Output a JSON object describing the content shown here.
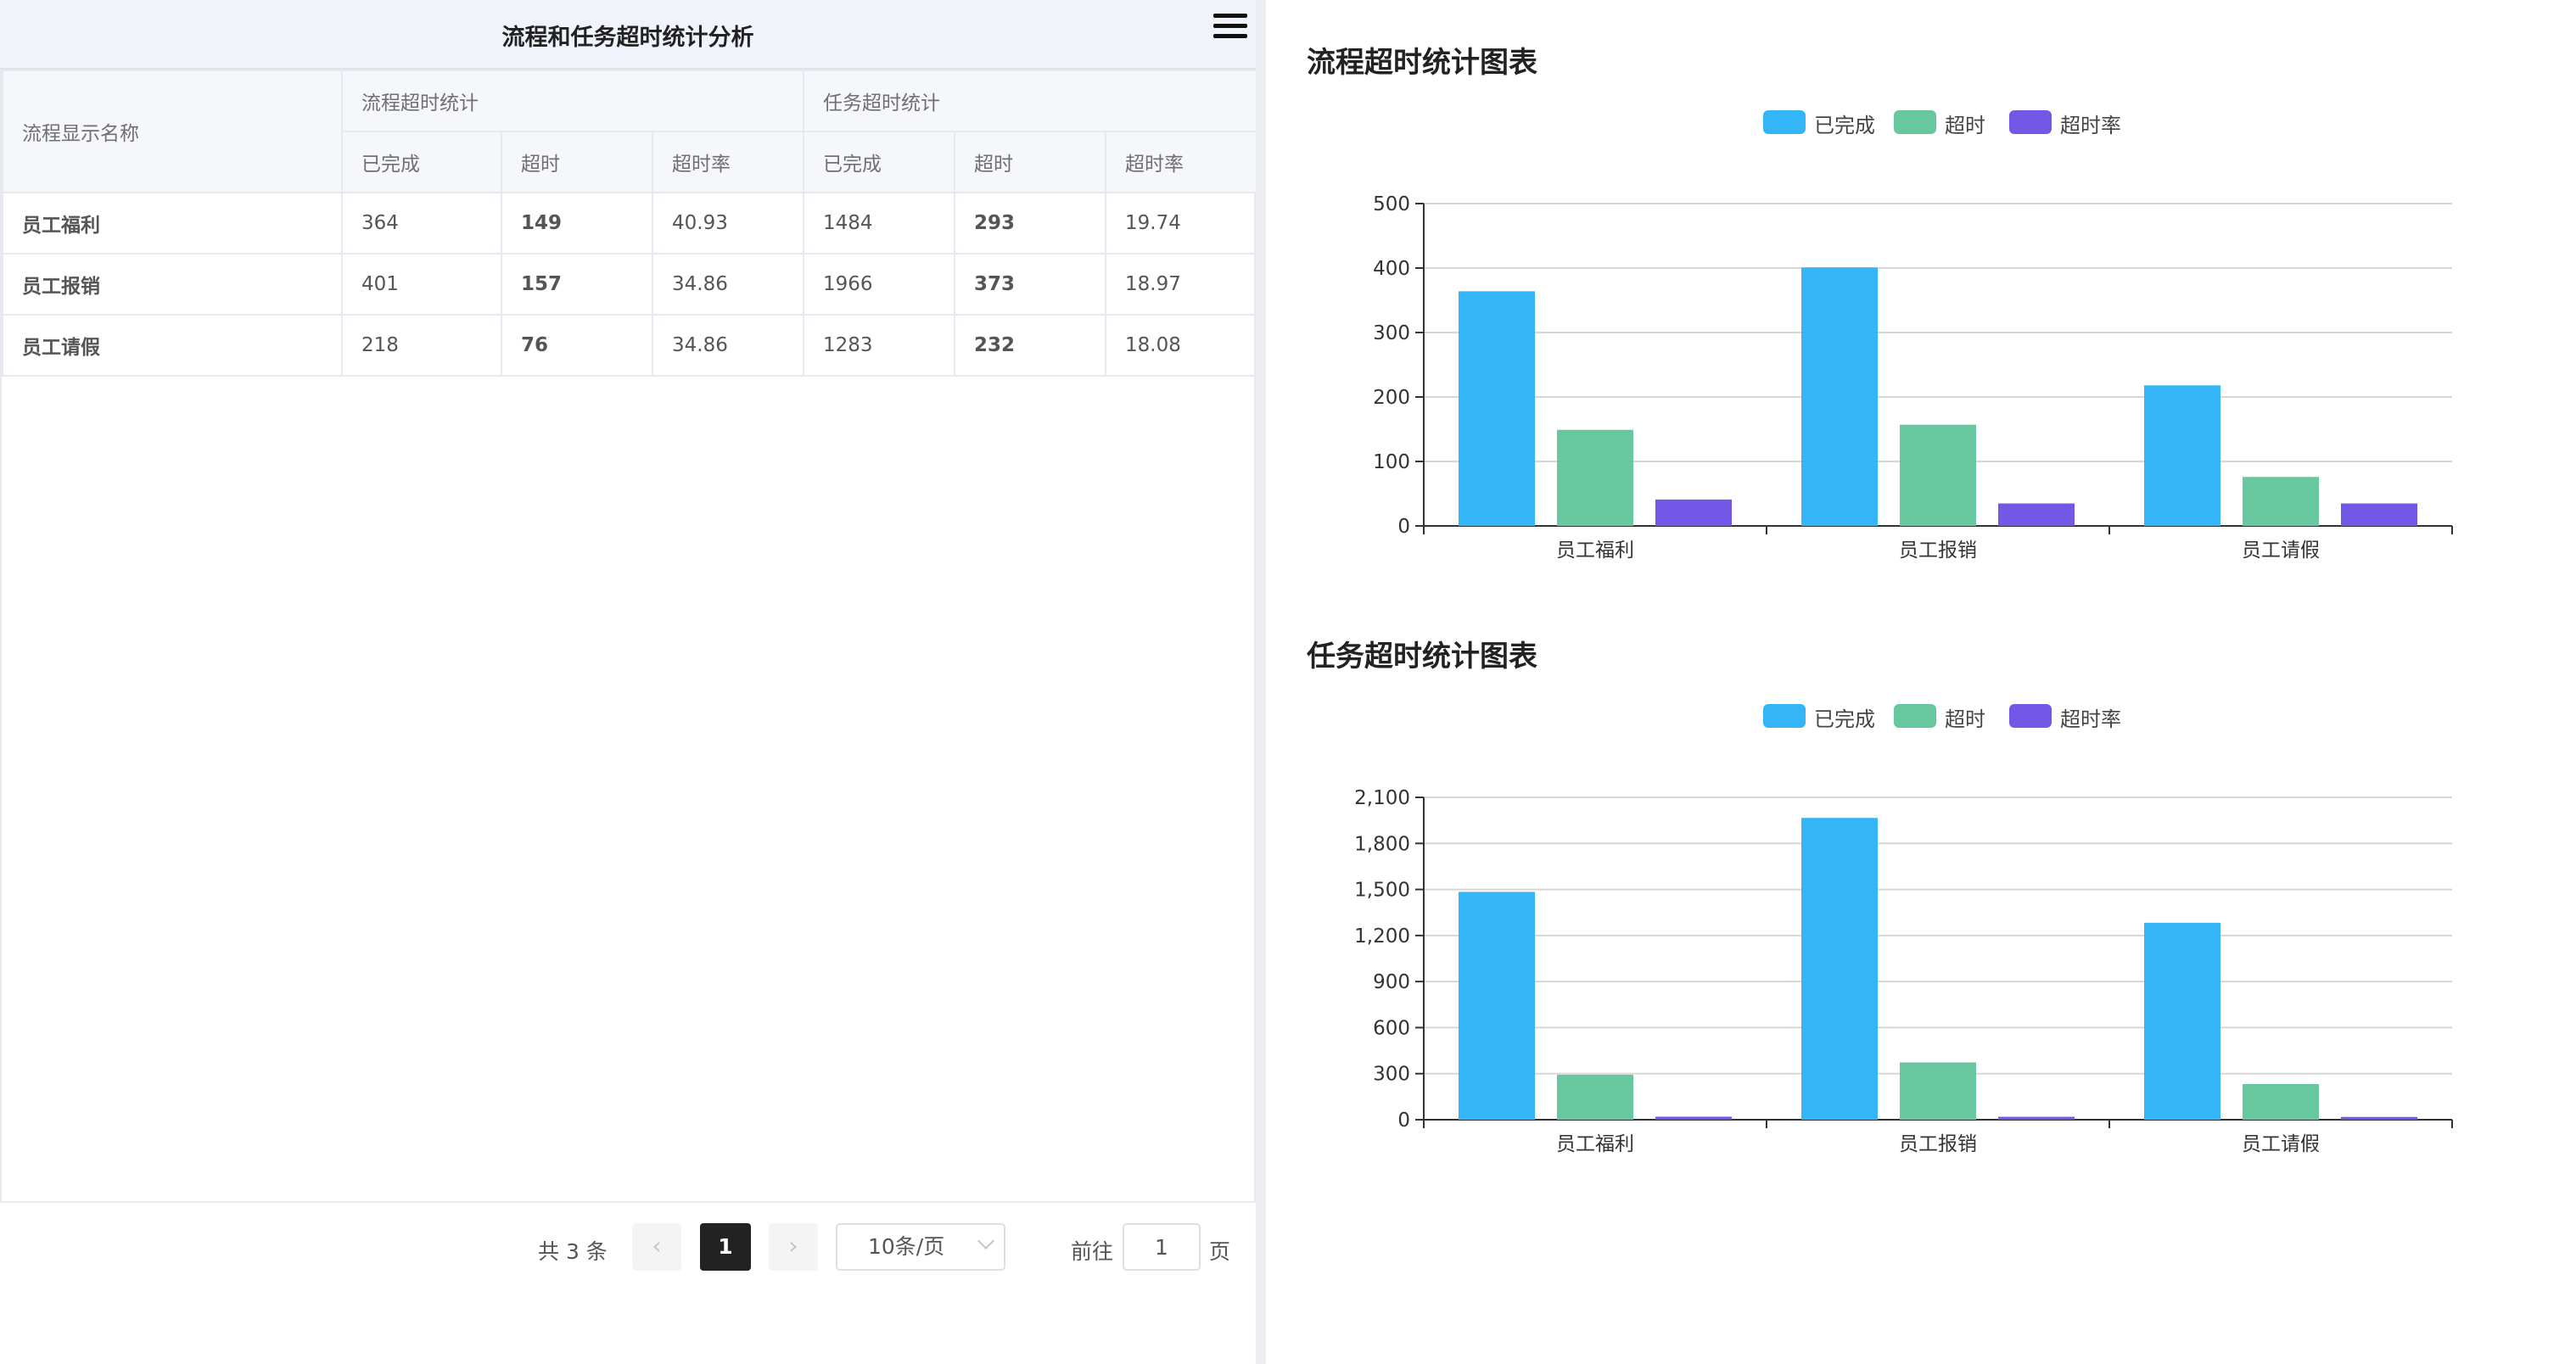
{
  "header": {
    "title": "流程和任务超时统计分析"
  },
  "table": {
    "name_header": "流程显示名称",
    "group_headers": [
      "流程超时统计",
      "任务超时统计"
    ],
    "sub_headers": [
      "已完成",
      "超时",
      "超时率",
      "已完成",
      "超时",
      "超时率"
    ],
    "rows": [
      {
        "name": "员工福利",
        "cells": [
          "364",
          "149",
          "40.93",
          "1484",
          "293",
          "19.74"
        ]
      },
      {
        "name": "员工报销",
        "cells": [
          "401",
          "157",
          "34.86",
          "1966",
          "373",
          "18.97"
        ]
      },
      {
        "name": "员工请假",
        "cells": [
          "218",
          "76",
          "34.86",
          "1283",
          "232",
          "18.08"
        ]
      }
    ]
  },
  "pagination": {
    "total": "共 3 条",
    "prev": "‹",
    "current": "1",
    "next": "›",
    "page_size": "10条/页",
    "goto_label": "前往",
    "goto_value": "1",
    "goto_suffix": "页"
  },
  "charts": {
    "process": {
      "title": "流程超时统计图表"
    },
    "task": {
      "title": "任务超时统计图表"
    }
  },
  "chart_data": [
    {
      "type": "bar",
      "title": "流程超时统计图表",
      "categories": [
        "员工福利",
        "员工报销",
        "员工请假"
      ],
      "series": [
        {
          "name": "已完成",
          "values": [
            364,
            401,
            218
          ],
          "color": "#33b5f7"
        },
        {
          "name": "超时",
          "values": [
            149,
            157,
            76
          ],
          "color": "#67c79f"
        },
        {
          "name": "超时率",
          "values": [
            40.93,
            34.86,
            34.86
          ],
          "color": "#7358e8"
        }
      ],
      "ylim": [
        0,
        500
      ],
      "yticks": [
        0,
        100,
        200,
        300,
        400,
        500
      ],
      "ytick_labels": [
        "0",
        "100",
        "200",
        "300",
        "400",
        "500"
      ],
      "grid": true,
      "legend": "top-center"
    },
    {
      "type": "bar",
      "title": "任务超时统计图表",
      "categories": [
        "员工福利",
        "员工报销",
        "员工请假"
      ],
      "series": [
        {
          "name": "已完成",
          "values": [
            1484,
            1966,
            1283
          ],
          "color": "#33b5f7"
        },
        {
          "name": "超时",
          "values": [
            293,
            373,
            232
          ],
          "color": "#67c79f"
        },
        {
          "name": "超时率",
          "values": [
            19.74,
            18.97,
            18.08
          ],
          "color": "#7358e8"
        }
      ],
      "ylim": [
        0,
        2100
      ],
      "yticks": [
        0,
        300,
        600,
        900,
        1200,
        1500,
        1800,
        2100
      ],
      "ytick_labels": [
        "0",
        "300",
        "600",
        "900",
        "1,200",
        "1,500",
        "1,800",
        "2,100"
      ],
      "grid": true,
      "legend": "top-center"
    }
  ]
}
